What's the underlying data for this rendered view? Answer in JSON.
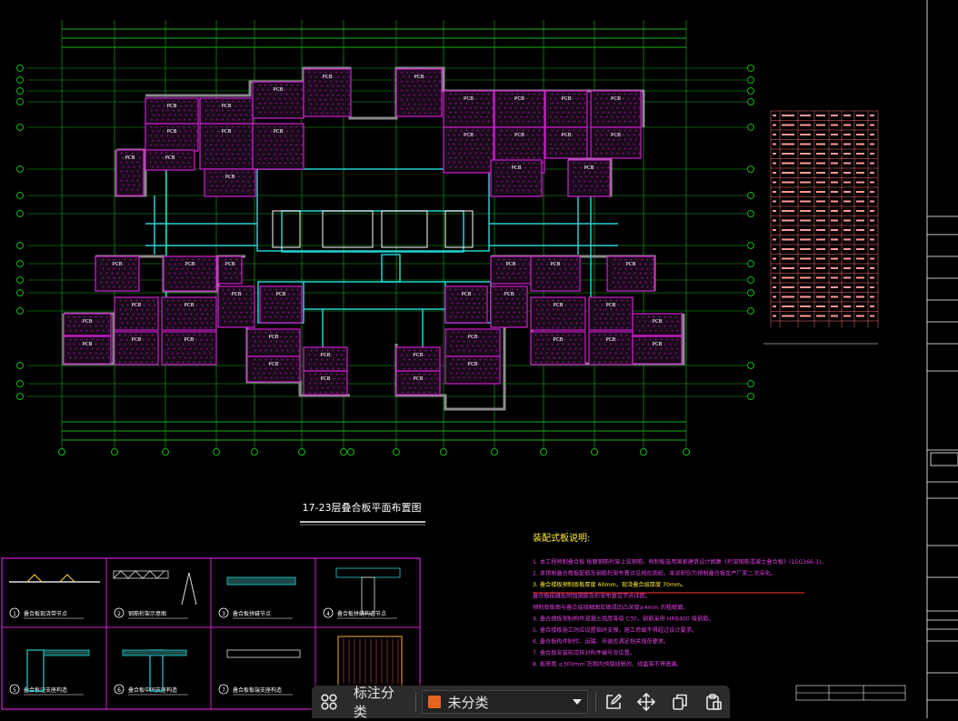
{
  "drawing": {
    "plan_title": "17-23层叠合板平面布置图",
    "panel_prefix": "PCB",
    "notes_title": "装配式板说明:",
    "notes": [
      "1. 本工程预制叠合板 板面钢筋桁架上弦钢筋，预制板选用国家建筑设计图集《桁架钢筋混凝土叠合板》(15G366-1)。",
      "2. 本预制叠合楼板配筋及钢筋桁架布置详见相应图纸，本说明仅为预制叠合板生产厂家二次深化。",
      "3. 叠合楼板预制底板厚度 60mm，现浇叠合层厚度 70mm。",
      "   叠合板接缝处附加钢筋及桁架布置见节点详图。",
      "   预制底板面与叠合层接触面应做成凹凸深度≥4mm 的粗糙面。",
      "4. 叠合楼板预制构件混凝土强度等级 C30，钢筋采用 HRB400 级钢筋。",
      "5. 叠合楼板施工时应设置临时支撑，施工荷载不得超过设计要求。",
      "6. 叠合板构件制作、运输、吊装应满足相关规范要求。",
      "7. 叠合板安装前应核对构件编号及位置。",
      "8. 板厚度 ≤300mm 范围内预埋线管的、线盒等不得遗漏。"
    ],
    "details": [
      {
        "num": "1",
        "title": "叠合板现浇带节点"
      },
      {
        "num": "2",
        "title": "钢筋桁架示意图"
      },
      {
        "num": "3",
        "title": "叠合板拼缝节点"
      },
      {
        "num": "4",
        "title": "叠合板拼缝构造节点"
      },
      {
        "num": "5",
        "title": "叠合板边支座构造"
      },
      {
        "num": "6",
        "title": "叠合板中间支座构造"
      },
      {
        "num": "7",
        "title": "叠合板板端支座构造"
      }
    ]
  },
  "toolbar": {
    "label_category": "标注分类",
    "category_value": "未分类",
    "category_color": "#e8641e"
  },
  "icons": {
    "grid": "grid-icon",
    "dropdown": "caret-down-icon",
    "edit": "edit-icon",
    "move": "move-icon",
    "copy": "copy-icon",
    "paste": "paste-icon"
  }
}
